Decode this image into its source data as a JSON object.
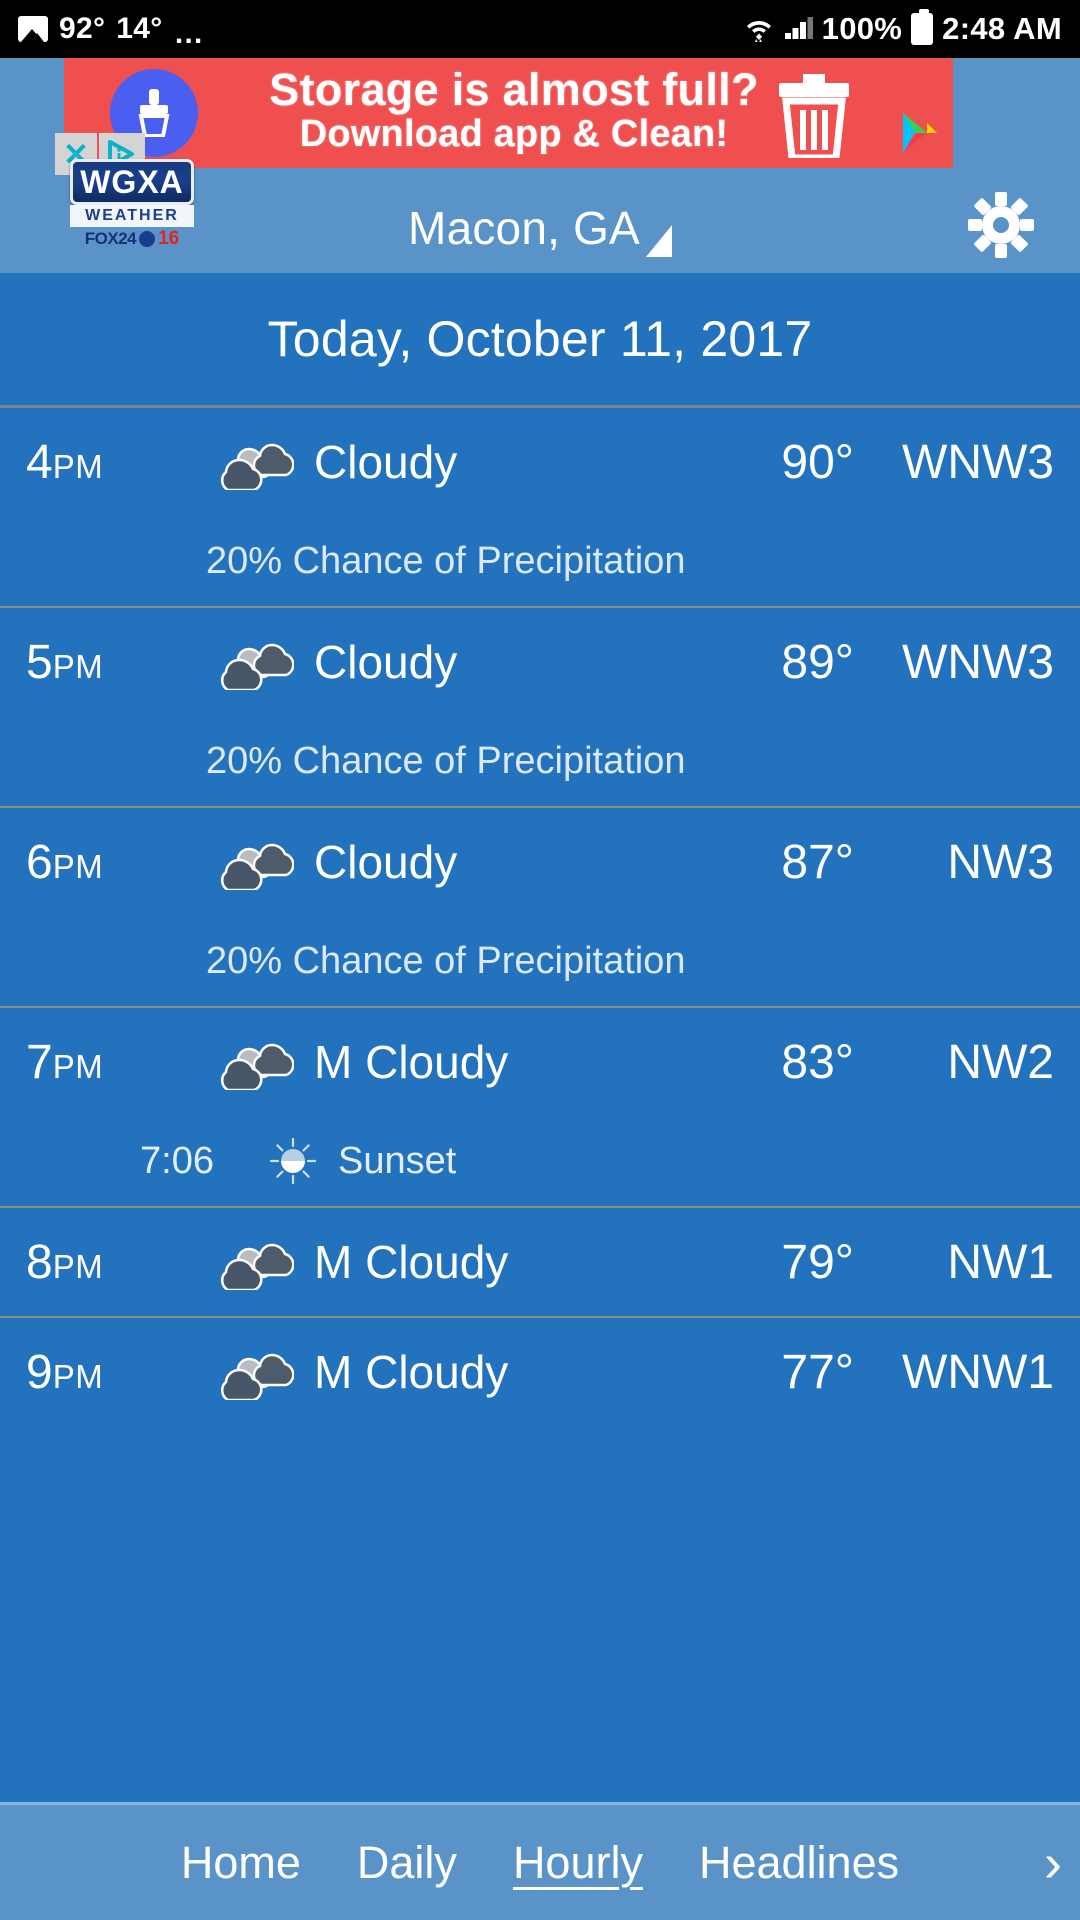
{
  "statusbar": {
    "image_icon": "picture-icon",
    "temp_primary": "92°",
    "temp_secondary": "14°",
    "overflow": "…",
    "wifi_icon": "wifi-icon",
    "signal_icon": "cellular-signal-icon",
    "battery_pct": "100%",
    "battery_icon": "battery-full-icon",
    "clock": "2:48 AM"
  },
  "ad": {
    "line1": "Storage is almost full?",
    "line2": "Download app & Clean!",
    "brush_icon": "broom-icon",
    "trash_icon": "trash-can-icon",
    "store_icon": "google-play-icon",
    "close_label": "✕",
    "adchoices_icon": "adchoices-icon",
    "bg_color": "#ef4f4f"
  },
  "header": {
    "logo": {
      "name": "WGXA",
      "sub": "WEATHER",
      "fox": "FOX24",
      "channel": "16"
    },
    "location": "Macon, GA",
    "location_caret": "dropdown-caret-icon",
    "settings_icon": "gear-icon",
    "bg_color": "#5a93c8"
  },
  "date_header": {
    "text": "Today, October 11, 2017"
  },
  "hourly": {
    "rows": [
      {
        "time": "4",
        "meridiem": "PM",
        "icon": "cloudy-icon",
        "condition": "Cloudy",
        "temp": "90°",
        "wind": "WNW3",
        "sub_type": "precip",
        "sub_text": "20% Chance of Precipitation"
      },
      {
        "time": "5",
        "meridiem": "PM",
        "icon": "cloudy-icon",
        "condition": "Cloudy",
        "temp": "89°",
        "wind": "WNW3",
        "sub_type": "precip",
        "sub_text": "20% Chance of Precipitation"
      },
      {
        "time": "6",
        "meridiem": "PM",
        "icon": "cloudy-icon",
        "condition": "Cloudy",
        "temp": "87°",
        "wind": "NW3",
        "sub_type": "precip",
        "sub_text": "20% Chance of Precipitation"
      },
      {
        "time": "7",
        "meridiem": "PM",
        "icon": "cloudy-icon",
        "condition": "M Cloudy",
        "temp": "83°",
        "wind": "NW2",
        "sub_type": "sunset",
        "sub_time": "7:06",
        "sub_text": "Sunset",
        "sub_icon": "sunset-icon"
      },
      {
        "time": "8",
        "meridiem": "PM",
        "icon": "cloudy-icon",
        "condition": "M Cloudy",
        "temp": "79°",
        "wind": "NW1",
        "sub_type": "none"
      },
      {
        "time": "9",
        "meridiem": "PM",
        "icon": "cloudy-icon",
        "condition": "M Cloudy",
        "temp": "77°",
        "wind": "WNW1",
        "sub_type": "none"
      }
    ]
  },
  "bottomnav": {
    "items": [
      {
        "label": "Home",
        "active": false
      },
      {
        "label": "Daily",
        "active": false
      },
      {
        "label": "Hourly",
        "active": true
      },
      {
        "label": "Headlines",
        "active": false
      }
    ],
    "chevron": "›"
  },
  "colors": {
    "body_bg": "#2372bd",
    "bar_bg": "#5a93c8",
    "divider": "#8a8f7f"
  }
}
